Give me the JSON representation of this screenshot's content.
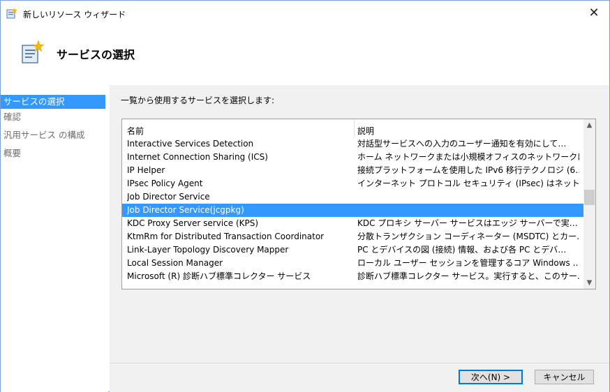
{
  "window": {
    "title": "新しいリソース ウィザード",
    "close_symbol": "✕"
  },
  "header": {
    "title": "サービスの選択"
  },
  "nav": {
    "items": [
      {
        "label": "サービスの選択",
        "active": true
      },
      {
        "label": "確認",
        "active": false
      },
      {
        "label": "汎用サービス の構成",
        "active": false
      },
      {
        "label": "概要",
        "active": false
      }
    ]
  },
  "main": {
    "instruction": "一覧から使用するサービスを選択します:",
    "columns": {
      "name": "名前",
      "description": "説明"
    },
    "rows": [
      {
        "name": "Interactive Services Detection",
        "description": "対話型サービスへの入力のユーザー通知を有効にして…",
        "selected": false
      },
      {
        "name": "Internet Connection Sharing (ICS)",
        "description": "ホーム ネットワークまたは小規模オフィスのネットワークに…",
        "selected": false
      },
      {
        "name": "IP Helper",
        "description": "接続プラットフォームを使用した IPv6 移行テクノロジ (6…",
        "selected": false
      },
      {
        "name": "IPsec Policy Agent",
        "description": "インターネット プロトコル セキュリティ (IPsec) はネットワ…",
        "selected": false
      },
      {
        "name": "Job Director Service",
        "description": "",
        "selected": false
      },
      {
        "name": "Job Director Service(jcgpkg)",
        "description": "",
        "selected": true
      },
      {
        "name": "KDC Proxy Server service (KPS)",
        "description": "KDC プロキシ サーバー サービスはエッジ サーバーで実…",
        "selected": false
      },
      {
        "name": "KtmRm for Distributed Transaction Coordinator",
        "description": "分散トランザクション コーディネーター (MSDTC) とカー…",
        "selected": false
      },
      {
        "name": "Link-Layer Topology Discovery Mapper",
        "description": "PC とデバイスの図 (接続) 情報、および各 PC とデバ…",
        "selected": false
      },
      {
        "name": "Local Session Manager",
        "description": "ローカル ユーザー セッションを管理するコア Windows …",
        "selected": false
      },
      {
        "name": "Microsoft (R) 診断ハブ標準コレクター サービス",
        "description": "診断ハブ標準コレクター サービス。実行すると、このサー…",
        "selected": false
      }
    ],
    "scroll_position": 0.45
  },
  "buttons": {
    "next": "次へ(N) >",
    "cancel": "キャンセル"
  }
}
